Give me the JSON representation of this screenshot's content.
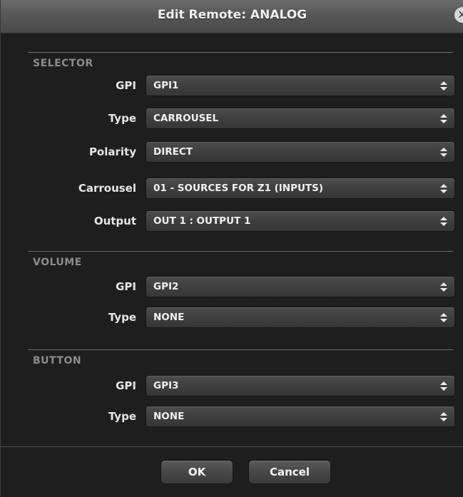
{
  "dialog": {
    "title": "Edit Remote: ANALOG",
    "close_glyph": "✕"
  },
  "sections": {
    "selector": {
      "label": "SELECTOR",
      "gpi_label": "GPI",
      "gpi_value": "GPI1",
      "type_label": "Type",
      "type_value": "CARROUSEL",
      "polarity_label": "Polarity",
      "polarity_value": "DIRECT",
      "carrousel_label": "Carrousel",
      "carrousel_value": "01 - SOURCES FOR Z1 (INPUTS)",
      "output_label": "Output",
      "output_value": "OUT 1 : OUTPUT 1"
    },
    "volume": {
      "label": "VOLUME",
      "gpi_label": "GPI",
      "gpi_value": "GPI2",
      "type_label": "Type",
      "type_value": "NONE"
    },
    "button": {
      "label": "BUTTON",
      "gpi_label": "GPI",
      "gpi_value": "GPI3",
      "type_label": "Type",
      "type_value": "NONE"
    }
  },
  "footer": {
    "ok_label": "OK",
    "cancel_label": "Cancel"
  },
  "icons": {
    "close": "close-icon",
    "select_arrows": "updown-arrows-icon"
  },
  "colors": {
    "dialog_bg": "#1e1e1e",
    "titlebar": "#555555",
    "select_bg": "#3f3f3f",
    "text": "#f0f0f0",
    "section_label": "#8c8c8c"
  }
}
